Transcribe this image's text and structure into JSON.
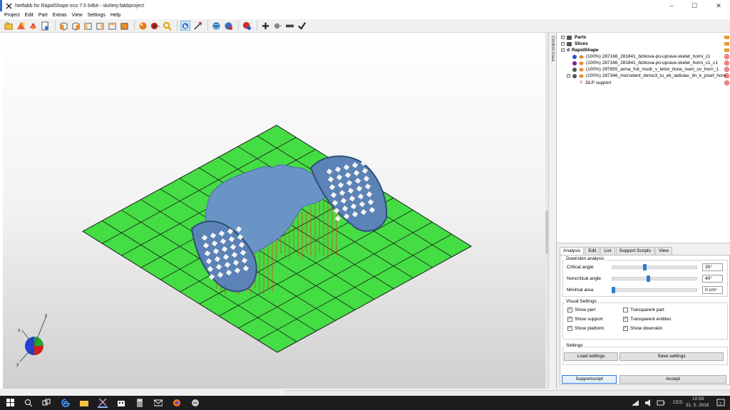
{
  "window": {
    "title": "Netfabb for RapidShape eco 7.5 64bit - skelety.fabbproject",
    "min_glyph": "–",
    "max_glyph": "☐",
    "close_glyph": "✕"
  },
  "menu": [
    "Project",
    "Edit",
    "Part",
    "Extras",
    "View",
    "Settings",
    "Help"
  ],
  "toolbar_icons": [
    "open-project-icon",
    "add-part-icon",
    "repair-icon",
    "settings-page-icon",
    "view-front-icon",
    "view-back-icon",
    "view-left-icon",
    "view-right-icon",
    "view-top-icon",
    "view-bottom-icon",
    "render-sphere-icon",
    "camera-icon",
    "zoom-icon",
    "select-icon",
    "move-icon",
    "globe-icon",
    "globe-settings-icon",
    "support-icon",
    "add-icon",
    "tool-dropdown-icon",
    "remove-icon",
    "check-icon"
  ],
  "control_area_label": "Control Area",
  "tree": {
    "parts_label": "Parts",
    "slices_label": "Slices",
    "rapidshape_label": "RapidShape",
    "items": [
      {
        "label": "(100%) 287166_281841_bizkova-po-uprave-skelet_horni_c1",
        "color": "#2a57c9"
      },
      {
        "label": "(100%) 287166_281841_bizkova-po-uprave-skelet_horni_c1_c1",
        "color": "#7a1f8c"
      },
      {
        "label": "(100%) 297855_anna_foit_mudr_v_letov_ilona_ivani_ov_horn_1",
        "color": "#555555"
      },
      {
        "label": "(100%) 287346_microdent_demo3_tu_ek_ladislav_itn_k_josef_horn",
        "color": "#555555"
      }
    ],
    "support_label": "DLP support"
  },
  "tabs": [
    "Analysis",
    "Edit",
    "List",
    "Support Scripts",
    "View"
  ],
  "analysis": {
    "downskin_title": "Downskin analysis",
    "critical_label": "Critical angle",
    "critical_value": "35°",
    "critical_level": 0.38,
    "noncritical_label": "Noncritical angle",
    "noncritical_value": "40°",
    "noncritical_level": 0.43,
    "minarea_label": "Minimal area",
    "minarea_value": "0 cm²",
    "minarea_level": 0.0,
    "visual_title": "Visual Settings",
    "checks": [
      {
        "label": "Show part",
        "checked": true
      },
      {
        "label": "Transparent part",
        "checked": false
      },
      {
        "label": "Show support",
        "checked": true
      },
      {
        "label": "Transparent entities",
        "checked": true
      },
      {
        "label": "Show platform",
        "checked": true
      },
      {
        "label": "Show downskin",
        "checked": true
      }
    ],
    "settings_title": "Settings",
    "load_label": "Load settings",
    "save_label": "Save settings"
  },
  "buttons": {
    "supportscript": "Supportscript",
    "accept": "Accept"
  },
  "axes": {
    "x": "x",
    "y": "y",
    "z": "z"
  },
  "colors": {
    "platform": "#44dd44",
    "part": "#6a93c6",
    "support": "#d94424",
    "accent": "#2d7bd1"
  },
  "taskbar": {
    "lang": "CES",
    "time": "10:59",
    "date": "31. 5. 2018",
    "notifications": "2"
  }
}
